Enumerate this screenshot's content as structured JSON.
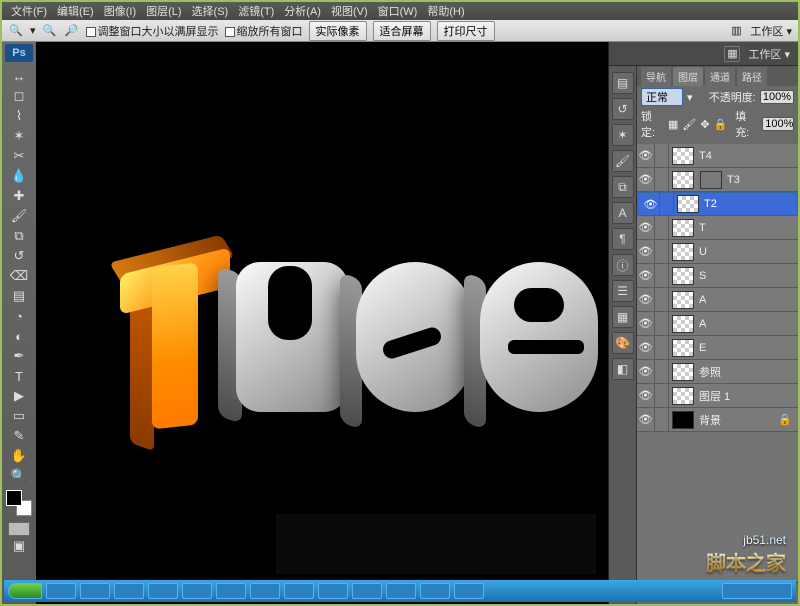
{
  "menu": {
    "file": "文件(F)",
    "edit": "编辑(E)",
    "image": "图像(I)",
    "layer": "图层(L)",
    "select": "选择(S)",
    "filter": "滤镜(T)",
    "analysis": "分析(A)",
    "view": "视图(V)",
    "window": "窗口(W)",
    "help": "帮助(H)"
  },
  "options": {
    "chk1": "调整窗口大小以满屏显示",
    "chk2": "缩放所有窗口",
    "btn_actual": "实际像素",
    "btn_fit": "适合屏幕",
    "btn_print": "打印尺寸",
    "workspace": "工作区"
  },
  "tabs": {
    "nav": "导航",
    "layers": "图层",
    "channels": "通道",
    "paths": "路径"
  },
  "layerprops": {
    "mode_label": "正常",
    "opacity_label": "不透明度:",
    "opacity": "100%",
    "lock_label": "锁定:",
    "fill_label": "填充:",
    "fill": "100%"
  },
  "layers": [
    {
      "name": "T4",
      "thumb": "check",
      "sel": false
    },
    {
      "name": "T3",
      "thumb": "check",
      "mask": true,
      "sel": false
    },
    {
      "name": "T2",
      "thumb": "check",
      "sel": true
    },
    {
      "name": "T",
      "thumb": "check",
      "sel": false
    },
    {
      "name": "U",
      "thumb": "check",
      "sel": false
    },
    {
      "name": "S",
      "thumb": "check",
      "sel": false
    },
    {
      "name": "A",
      "thumb": "check",
      "sel": false
    },
    {
      "name": "A",
      "thumb": "check",
      "sel": false
    },
    {
      "name": "E",
      "thumb": "check",
      "sel": false
    },
    {
      "name": "参照",
      "thumb": "check",
      "sel": false
    },
    {
      "name": "图层 1",
      "thumb": "check",
      "sel": false
    },
    {
      "name": "背景",
      "thumb": "black",
      "locked": true,
      "sel": false
    }
  ],
  "canvas_text": "tuse",
  "watermark": {
    "url": "jb51.net",
    "brand": "脚本之家"
  }
}
